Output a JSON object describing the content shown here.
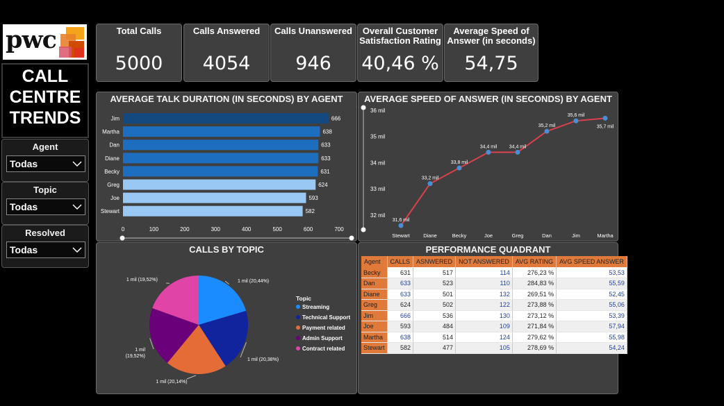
{
  "logo": {
    "text": "pwc"
  },
  "title": {
    "line1": "CALL",
    "line2": "CENTRE",
    "line3": "TRENDS"
  },
  "filters": [
    {
      "label": "Agent",
      "value": "Todas"
    },
    {
      "label": "Topic",
      "value": "Todas"
    },
    {
      "label": "Resolved",
      "value": "Todas"
    }
  ],
  "kpis": [
    {
      "title": "Total Calls",
      "value": "5000"
    },
    {
      "title": "Calls Answered",
      "value": "4054"
    },
    {
      "title": "Calls Unanswered",
      "value": "946"
    },
    {
      "title": "Overall Customer Satisfaction Rating",
      "value": "40,46 %"
    },
    {
      "title": "Average Speed of Answer (in seconds)",
      "value": "54,75"
    }
  ],
  "colors": {
    "bar_dark": "#14497f",
    "bar_mid": "#1e6ec0",
    "bar_light": "#99c8f5",
    "line": "#d9404c",
    "point": "#4a8fd6",
    "pie": [
      "#1a8cff",
      "#12239e",
      "#e66c37",
      "#6b007b",
      "#e044a7"
    ],
    "table_header": "#e07a3a"
  },
  "chart_data": [
    {
      "type": "bar",
      "orientation": "horizontal",
      "title": "AVERAGE TALK DURATION (IN SECONDS) BY AGENT",
      "categories": [
        "Jim",
        "Martha",
        "Dan",
        "Diane",
        "Becky",
        "Greg",
        "Joe",
        "Stewart"
      ],
      "values": [
        666,
        638,
        633,
        633,
        631,
        624,
        593,
        582
      ],
      "xlim": [
        0,
        700
      ],
      "xticks": [
        "0",
        "100",
        "200",
        "300",
        "400",
        "500",
        "600",
        "700"
      ]
    },
    {
      "type": "line",
      "title": "AVERAGE SPEED OF ANSWER (IN SECONDS) BY AGENT",
      "categories": [
        "Stewart",
        "Diane",
        "Becky",
        "Joe",
        "Greg",
        "Dan",
        "Jim",
        "Martha"
      ],
      "values": [
        31.6,
        33.2,
        33.8,
        34.4,
        34.4,
        35.2,
        35.6,
        35.7
      ],
      "labels": [
        "31,6 mil",
        "33,2 mil",
        "33,8 mil",
        "34,4 mil",
        "34,4 mil",
        "35,2 mil",
        "35,6 mil",
        "35,7 mil"
      ],
      "ylim": [
        31.6,
        36
      ],
      "yticks": [
        {
          "value": 32,
          "label": "32 mil"
        },
        {
          "value": 33,
          "label": "33 mil"
        },
        {
          "value": 34,
          "label": "34 mil"
        },
        {
          "value": 35,
          "label": "35 mil"
        },
        {
          "value": 36,
          "label": "36 mil"
        }
      ]
    },
    {
      "type": "pie",
      "title": "CALLS BY TOPIC",
      "legend_title": "Topic",
      "legend_position": "right",
      "slices": [
        {
          "name": "Streaming",
          "value": 20.44,
          "label": "1 mil (20,44%)"
        },
        {
          "name": "Technical Support",
          "value": 20.38,
          "label": "1 mil (20,38%)"
        },
        {
          "name": "Payment related",
          "value": 20.14,
          "label": "1 mil (20,14%)"
        },
        {
          "name": "Admin Support",
          "value": 19.52,
          "label": "1 mil (19,52%)"
        },
        {
          "name": "Contract related",
          "value": 19.52,
          "label": "1 mil (19,52%)"
        }
      ]
    },
    {
      "type": "table",
      "title": "PERFORMANCE QUADRANT",
      "columns": [
        "Agent",
        "CALLS",
        "ASNWERED",
        "NOT ANSWERED",
        "AVG RATING",
        "AVG SPEED ANSWER"
      ],
      "rows": [
        [
          "Becky",
          "631",
          "517",
          "114",
          "276,23 %",
          "53,53"
        ],
        [
          "Dan",
          "633",
          "523",
          "110",
          "284,83 %",
          "55,59"
        ],
        [
          "Diane",
          "633",
          "501",
          "132",
          "269,51 %",
          "52,45"
        ],
        [
          "Greg",
          "624",
          "502",
          "122",
          "273,88 %",
          "55,06"
        ],
        [
          "Jim",
          "666",
          "536",
          "130",
          "273,12 %",
          "53,39"
        ],
        [
          "Joe",
          "593",
          "484",
          "109",
          "271,84 %",
          "57,94"
        ],
        [
          "Martha",
          "638",
          "514",
          "124",
          "279,62 %",
          "55,98"
        ],
        [
          "Stewart",
          "582",
          "477",
          "105",
          "278,69 %",
          "54,24"
        ]
      ]
    }
  ]
}
